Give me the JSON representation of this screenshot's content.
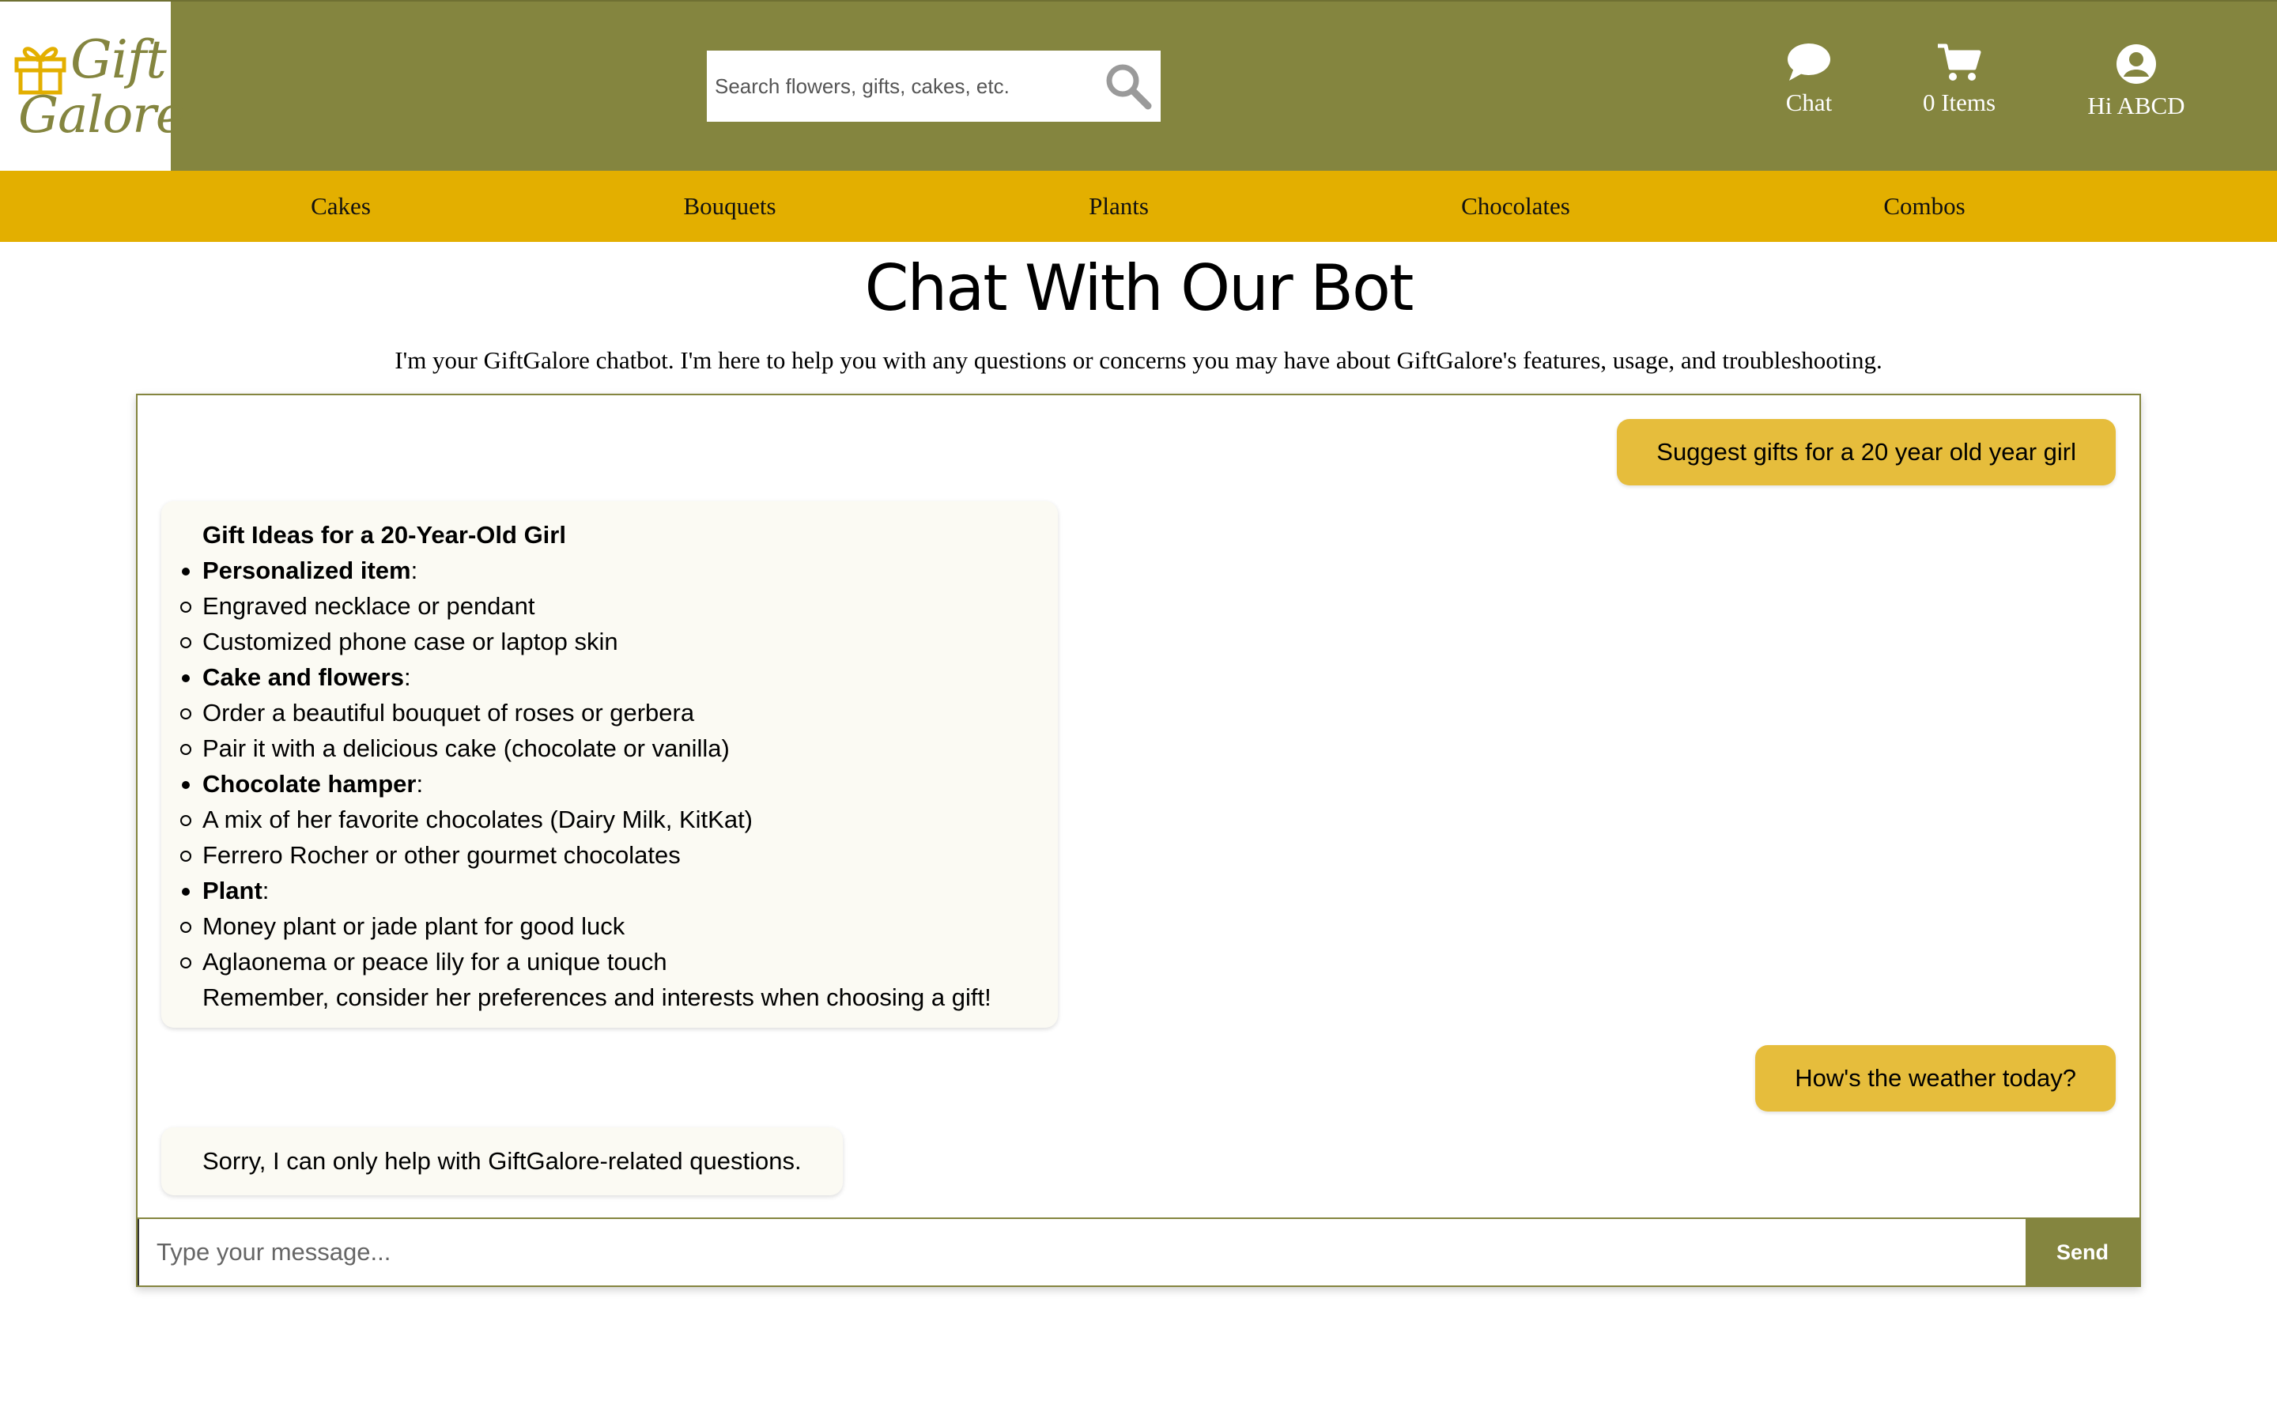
{
  "brand": {
    "logo_line1": "Gift",
    "logo_line2": "Galore",
    "colors": {
      "header": "#84853f",
      "category_bar": "#e3af00",
      "user_bubble": "#e6bd3c",
      "bot_bubble": "#fbfaf3"
    }
  },
  "search": {
    "placeholder": "Search flowers, gifts, cakes, etc.",
    "icon": "search-icon"
  },
  "header_actions": {
    "chat": {
      "label": "Chat",
      "icon": "chat-bubble-icon"
    },
    "cart": {
      "label": "0 Items",
      "icon": "cart-icon"
    },
    "user": {
      "label": "Hi ABCD",
      "icon": "user-circle-icon"
    }
  },
  "categories": [
    "Cakes",
    "Bouquets",
    "Plants",
    "Chocolates",
    "Combos"
  ],
  "page": {
    "title": "Chat With Our Bot",
    "subtitle": "I'm your GiftGalore chatbot. I'm here to help you with any questions or concerns you may have about GiftGalore's features, usage, and troubleshooting."
  },
  "chat": {
    "user_message_1": "Suggest gifts for a 20 year old year girl",
    "bot_reply_1": {
      "title": "Gift Ideas for a 20-Year-Old Girl",
      "sections": [
        {
          "heading": "Personalized item",
          "items": [
            "Engraved necklace or pendant",
            "Customized phone case or laptop skin"
          ]
        },
        {
          "heading": "Cake and flowers",
          "items": [
            "Order a beautiful bouquet of roses or gerbera",
            "Pair it with a delicious cake (chocolate or vanilla)"
          ]
        },
        {
          "heading": "Chocolate hamper",
          "items": [
            "A mix of her favorite chocolates (Dairy Milk, KitKat)",
            "Ferrero Rocher or other gourmet chocolates"
          ]
        },
        {
          "heading": "Plant",
          "items": [
            "Money plant or jade plant for good luck",
            "Aglaonema or peace lily for a unique touch"
          ]
        }
      ],
      "closing": "Remember, consider her preferences and interests when choosing a gift!"
    },
    "user_message_2": "How's the weather today?",
    "bot_reply_2": "Sorry, I can only help with GiftGalore-related questions.",
    "input_placeholder": "Type your message...",
    "send_label": "Send"
  }
}
